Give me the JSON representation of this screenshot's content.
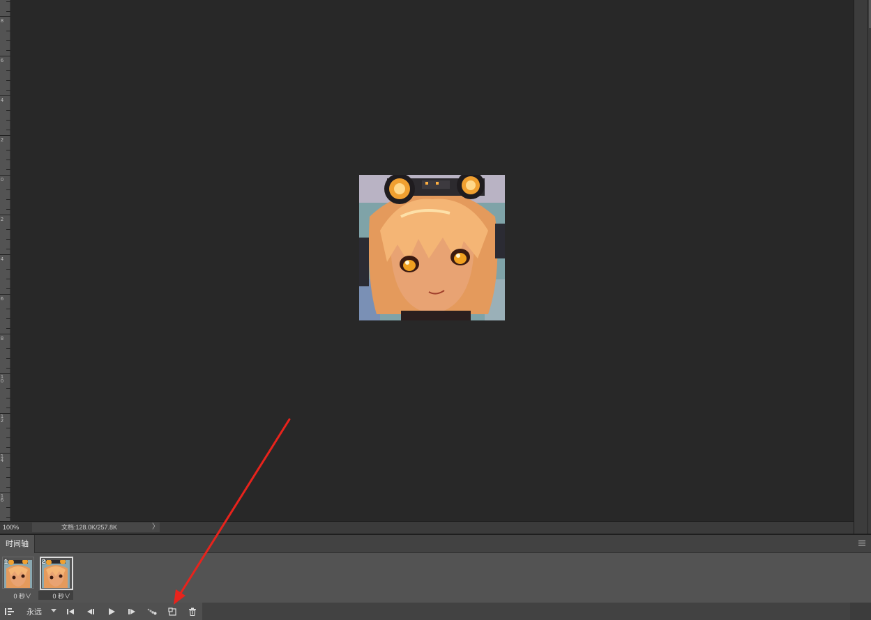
{
  "ruler": {
    "labels": [
      "8",
      "6",
      "4",
      "2",
      "0",
      "2",
      "4",
      "6",
      "8",
      "1\n0",
      "1\n2",
      "1\n4",
      "1\n6"
    ]
  },
  "status_bar": {
    "zoom": "100%",
    "doc_info": "文档:128.0K/257.8K",
    "arrow": "〉"
  },
  "timeline": {
    "tab_label": "时间轴",
    "frames": [
      {
        "number": "1",
        "delay": "0 秒∨"
      },
      {
        "number": "2",
        "delay": "0 秒∨"
      }
    ],
    "loop": "永远"
  },
  "colors": {
    "canvas_bg": "#282828",
    "panel_bg": "#535353",
    "annotation_arrow": "#e8231c"
  },
  "icons": {
    "convert": "timeline-convert-icon",
    "first": "first-frame-icon",
    "prev": "prev-frame-icon",
    "play": "play-icon",
    "next": "next-frame-icon",
    "tween": "tween-icon",
    "duplicate": "duplicate-frame-icon",
    "delete": "trash-icon"
  }
}
